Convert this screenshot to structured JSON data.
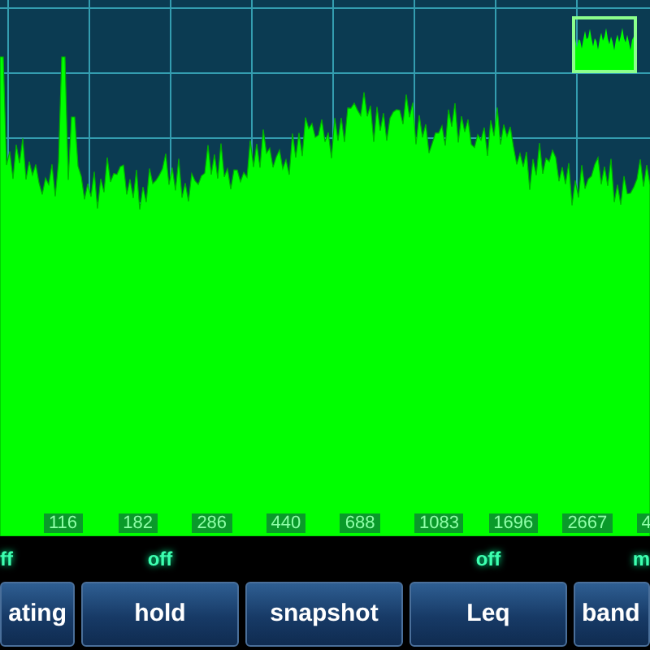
{
  "spectrum": {
    "frequency_labels": [
      "116",
      "182",
      "286",
      "440",
      "688",
      "1083",
      "1696",
      "2667",
      "4"
    ]
  },
  "controls": [
    {
      "status": "ff",
      "label": "ating"
    },
    {
      "status": "off",
      "label": "hold"
    },
    {
      "label": "snapshot"
    },
    {
      "status": "off",
      "label": "Leq"
    },
    {
      "status": "m",
      "label": "band"
    }
  ]
}
